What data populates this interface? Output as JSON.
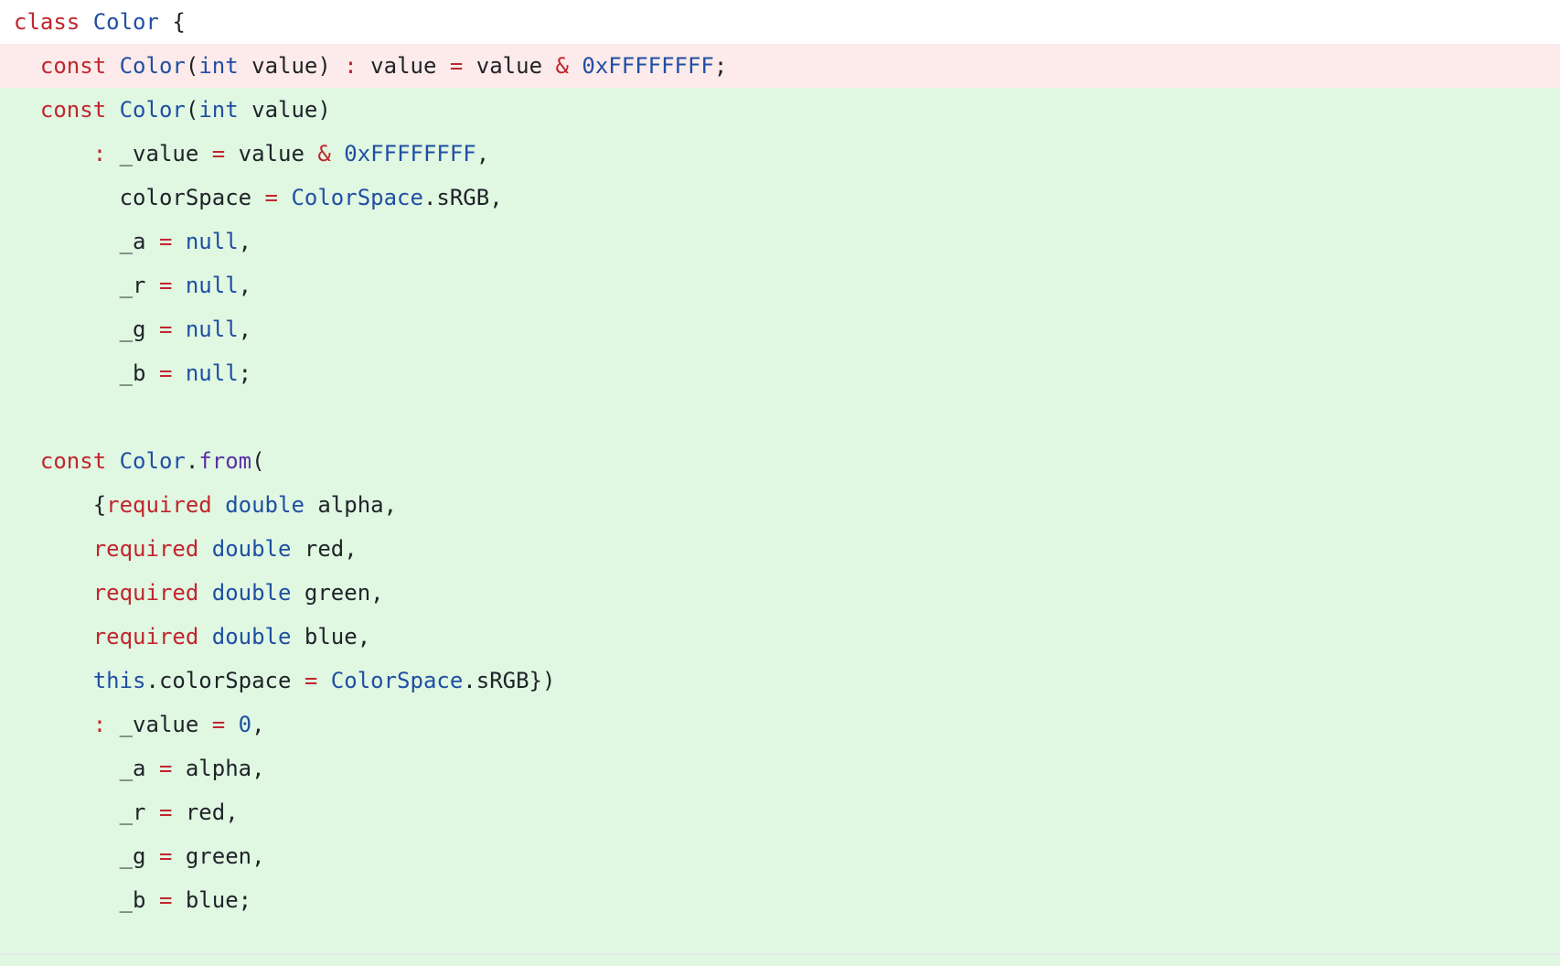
{
  "diff": {
    "colors": {
      "removed_background": "#fdeaea",
      "added_background": "#e0f7e2",
      "keyword": "#c0262d",
      "type": "#1f4fa3",
      "method": "#5a32a3",
      "text": "#1f2328"
    },
    "lines": [
      {
        "kind": "context",
        "tokens": [
          {
            "t": "class",
            "k": "keyword"
          },
          {
            "t": " ",
            "k": "plain"
          },
          {
            "t": "Color",
            "k": "type"
          },
          {
            "t": " {",
            "k": "plain"
          }
        ]
      },
      {
        "kind": "removed",
        "tokens": [
          {
            "t": "  ",
            "k": "plain"
          },
          {
            "t": "const",
            "k": "keyword"
          },
          {
            "t": " ",
            "k": "plain"
          },
          {
            "t": "Color",
            "k": "type"
          },
          {
            "t": "(",
            "k": "plain"
          },
          {
            "t": "int",
            "k": "type"
          },
          {
            "t": " value) ",
            "k": "plain"
          },
          {
            "t": ":",
            "k": "operator"
          },
          {
            "t": " value ",
            "k": "plain"
          },
          {
            "t": "=",
            "k": "operator"
          },
          {
            "t": " value ",
            "k": "plain"
          },
          {
            "t": "&",
            "k": "operator"
          },
          {
            "t": " ",
            "k": "plain"
          },
          {
            "t": "0xFFFFFFFF",
            "k": "number"
          },
          {
            "t": ";",
            "k": "plain"
          }
        ]
      },
      {
        "kind": "added",
        "tokens": [
          {
            "t": "  ",
            "k": "plain"
          },
          {
            "t": "const",
            "k": "keyword"
          },
          {
            "t": " ",
            "k": "plain"
          },
          {
            "t": "Color",
            "k": "type"
          },
          {
            "t": "(",
            "k": "plain"
          },
          {
            "t": "int",
            "k": "type"
          },
          {
            "t": " value)",
            "k": "plain"
          }
        ]
      },
      {
        "kind": "added",
        "tokens": [
          {
            "t": "      ",
            "k": "plain"
          },
          {
            "t": ":",
            "k": "operator"
          },
          {
            "t": " _value ",
            "k": "plain"
          },
          {
            "t": "=",
            "k": "operator"
          },
          {
            "t": " value ",
            "k": "plain"
          },
          {
            "t": "&",
            "k": "operator"
          },
          {
            "t": " ",
            "k": "plain"
          },
          {
            "t": "0xFFFFFFFF",
            "k": "number"
          },
          {
            "t": ",",
            "k": "plain"
          }
        ]
      },
      {
        "kind": "added",
        "tokens": [
          {
            "t": "        colorSpace ",
            "k": "plain"
          },
          {
            "t": "=",
            "k": "operator"
          },
          {
            "t": " ",
            "k": "plain"
          },
          {
            "t": "ColorSpace",
            "k": "type"
          },
          {
            "t": ".sRGB,",
            "k": "plain"
          }
        ]
      },
      {
        "kind": "added",
        "tokens": [
          {
            "t": "        _a ",
            "k": "plain"
          },
          {
            "t": "=",
            "k": "operator"
          },
          {
            "t": " ",
            "k": "plain"
          },
          {
            "t": "null",
            "k": "type"
          },
          {
            "t": ",",
            "k": "plain"
          }
        ]
      },
      {
        "kind": "added",
        "tokens": [
          {
            "t": "        _r ",
            "k": "plain"
          },
          {
            "t": "=",
            "k": "operator"
          },
          {
            "t": " ",
            "k": "plain"
          },
          {
            "t": "null",
            "k": "type"
          },
          {
            "t": ",",
            "k": "plain"
          }
        ]
      },
      {
        "kind": "added",
        "tokens": [
          {
            "t": "        _g ",
            "k": "plain"
          },
          {
            "t": "=",
            "k": "operator"
          },
          {
            "t": " ",
            "k": "plain"
          },
          {
            "t": "null",
            "k": "type"
          },
          {
            "t": ",",
            "k": "plain"
          }
        ]
      },
      {
        "kind": "added",
        "tokens": [
          {
            "t": "        _b ",
            "k": "plain"
          },
          {
            "t": "=",
            "k": "operator"
          },
          {
            "t": " ",
            "k": "plain"
          },
          {
            "t": "null",
            "k": "type"
          },
          {
            "t": ";",
            "k": "plain"
          }
        ]
      },
      {
        "kind": "added",
        "tokens": []
      },
      {
        "kind": "added",
        "tokens": [
          {
            "t": "  ",
            "k": "plain"
          },
          {
            "t": "const",
            "k": "keyword"
          },
          {
            "t": " ",
            "k": "plain"
          },
          {
            "t": "Color",
            "k": "type"
          },
          {
            "t": ".",
            "k": "plain"
          },
          {
            "t": "from",
            "k": "method"
          },
          {
            "t": "(",
            "k": "plain"
          }
        ]
      },
      {
        "kind": "added",
        "tokens": [
          {
            "t": "      {",
            "k": "plain"
          },
          {
            "t": "required",
            "k": "keyword"
          },
          {
            "t": " ",
            "k": "plain"
          },
          {
            "t": "double",
            "k": "type"
          },
          {
            "t": " alpha,",
            "k": "plain"
          }
        ]
      },
      {
        "kind": "added",
        "tokens": [
          {
            "t": "      ",
            "k": "plain"
          },
          {
            "t": "required",
            "k": "keyword"
          },
          {
            "t": " ",
            "k": "plain"
          },
          {
            "t": "double",
            "k": "type"
          },
          {
            "t": " red,",
            "k": "plain"
          }
        ]
      },
      {
        "kind": "added",
        "tokens": [
          {
            "t": "      ",
            "k": "plain"
          },
          {
            "t": "required",
            "k": "keyword"
          },
          {
            "t": " ",
            "k": "plain"
          },
          {
            "t": "double",
            "k": "type"
          },
          {
            "t": " green,",
            "k": "plain"
          }
        ]
      },
      {
        "kind": "added",
        "tokens": [
          {
            "t": "      ",
            "k": "plain"
          },
          {
            "t": "required",
            "k": "keyword"
          },
          {
            "t": " ",
            "k": "plain"
          },
          {
            "t": "double",
            "k": "type"
          },
          {
            "t": " blue,",
            "k": "plain"
          }
        ]
      },
      {
        "kind": "added",
        "tokens": [
          {
            "t": "      ",
            "k": "plain"
          },
          {
            "t": "this",
            "k": "type"
          },
          {
            "t": ".colorSpace ",
            "k": "plain"
          },
          {
            "t": "=",
            "k": "operator"
          },
          {
            "t": " ",
            "k": "plain"
          },
          {
            "t": "ColorSpace",
            "k": "type"
          },
          {
            "t": ".sRGB})",
            "k": "plain"
          }
        ]
      },
      {
        "kind": "added",
        "tokens": [
          {
            "t": "      ",
            "k": "plain"
          },
          {
            "t": ":",
            "k": "operator"
          },
          {
            "t": " _value ",
            "k": "plain"
          },
          {
            "t": "=",
            "k": "operator"
          },
          {
            "t": " ",
            "k": "plain"
          },
          {
            "t": "0",
            "k": "number"
          },
          {
            "t": ",",
            "k": "plain"
          }
        ]
      },
      {
        "kind": "added",
        "tokens": [
          {
            "t": "        _a ",
            "k": "plain"
          },
          {
            "t": "=",
            "k": "operator"
          },
          {
            "t": " alpha,",
            "k": "plain"
          }
        ]
      },
      {
        "kind": "added",
        "tokens": [
          {
            "t": "        _r ",
            "k": "plain"
          },
          {
            "t": "=",
            "k": "operator"
          },
          {
            "t": " red,",
            "k": "plain"
          }
        ]
      },
      {
        "kind": "added",
        "tokens": [
          {
            "t": "        _g ",
            "k": "plain"
          },
          {
            "t": "=",
            "k": "operator"
          },
          {
            "t": " green,",
            "k": "plain"
          }
        ]
      },
      {
        "kind": "added",
        "tokens": [
          {
            "t": "        _b ",
            "k": "plain"
          },
          {
            "t": "=",
            "k": "operator"
          },
          {
            "t": " blue;",
            "k": "plain"
          }
        ]
      },
      {
        "kind": "added",
        "tokens": []
      }
    ]
  }
}
